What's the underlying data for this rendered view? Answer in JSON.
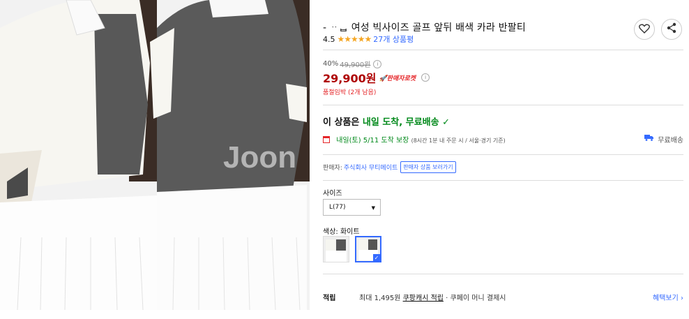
{
  "product": {
    "title": "- ᆢᆸ 여성 빅사이즈 골프 앞뒤 배색 카라 반팔티",
    "rating": "4.5",
    "stars": "★★★★★",
    "review_count": "27개 상품평",
    "watermark": "Joon"
  },
  "price": {
    "discount_rate": "40%",
    "original": "49,900원",
    "info": "i",
    "sale": "29,900원",
    "badge": "🚀판매자로켓",
    "limit_notice": "품절임박 (2개 남음)"
  },
  "delivery": {
    "headline_prefix": "이 상품은 ",
    "headline_green": "내일 도착, 무료배송",
    "check": "✓",
    "date_green": "내일(토) 5/11 도착 보장",
    "date_note": " (8시간 1분  내 주문 시 / 서울·경기 기준)",
    "free_shipping": "무료배송"
  },
  "seller": {
    "label": "판매자: ",
    "name": "주식회사 무티메이트",
    "button": "판매자 상품 보러가기"
  },
  "options": {
    "size_label": "사이즈",
    "size_value": "L(77)",
    "size_caret": "▼",
    "color_label": "색상: 화이트",
    "selected_check": "✓"
  },
  "reward": {
    "label": "적립",
    "text_prefix": "최대 1,495원 ",
    "text_link": "쿠팡캐시 적립",
    "text_suffix": " · 쿠페이 머니 결제시",
    "benefit": "혜택보기 ›"
  },
  "colors": {
    "accent": "#346aff",
    "price": "#ae0000",
    "green": "#00891a",
    "rocket": "#e52528"
  }
}
